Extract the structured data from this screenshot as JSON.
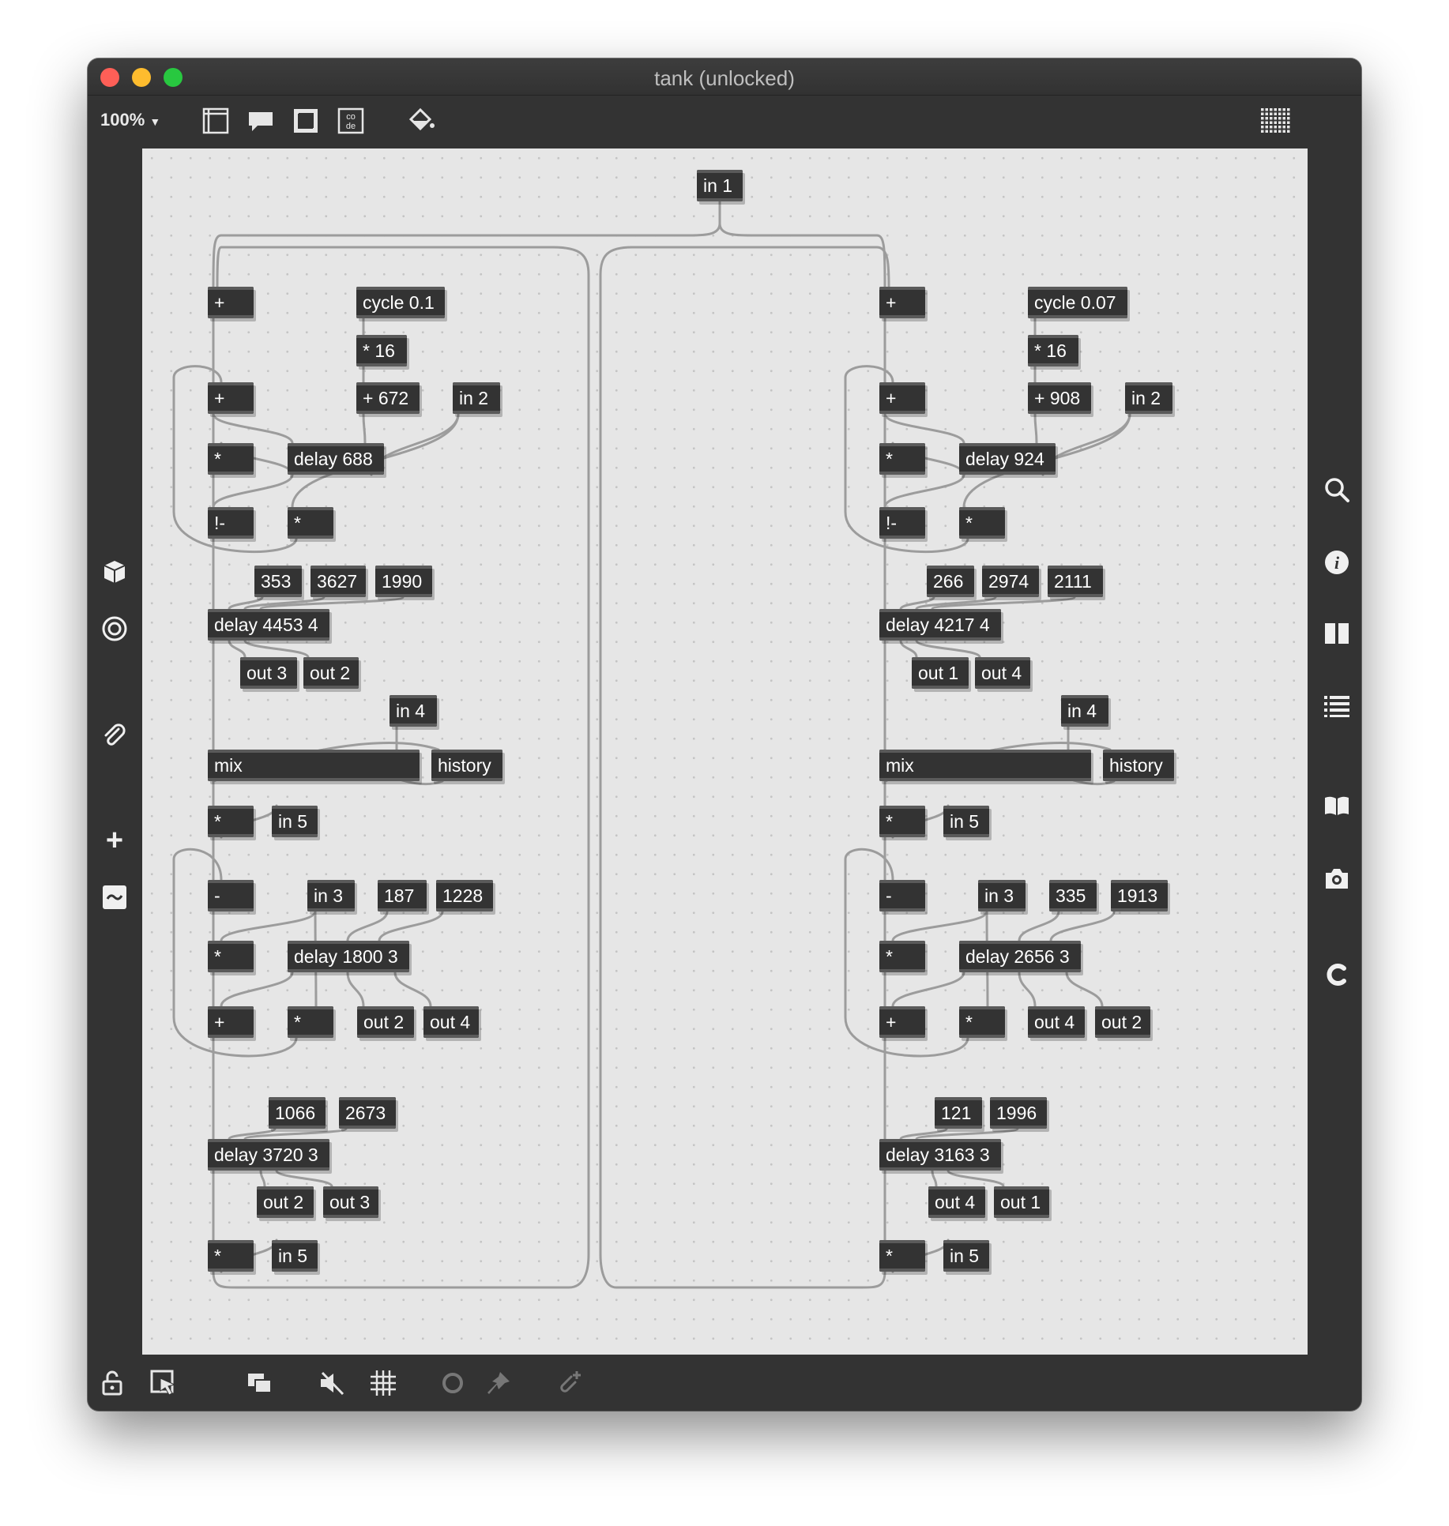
{
  "window": {
    "title": "tank (unlocked)",
    "zoom": "100%"
  },
  "colors": {
    "canvas": "#e6e6e6",
    "object": "#333333",
    "cord": "#9c9c9c",
    "close": "#fe5f57",
    "minimize": "#febc2e",
    "zoom": "#28c840"
  },
  "toolbar": {
    "icons": [
      "presentation-icon",
      "comment-icon",
      "area-icon",
      "code-icon",
      "paint-bucket-icon",
      "grid-menu-icon"
    ]
  },
  "left_sidebar": {
    "icons": [
      "package-icon",
      "target-icon",
      "paperclip-icon",
      "plus-icon",
      "tilde-icon"
    ]
  },
  "right_sidebar": {
    "icons": [
      "search-icon",
      "info-icon",
      "columns-icon",
      "list-icon",
      "book-icon",
      "camera-icon",
      "c-icon"
    ]
  },
  "bottom_toolbar": {
    "icons": [
      "lock-icon",
      "select-icon",
      "layers-icon",
      "mute-icon",
      "grid-icon",
      "loop-icon",
      "pin-icon",
      "paperclip-add-icon"
    ]
  },
  "objects": {
    "in1": "in 1",
    "l_add1": "+",
    "l_cycle": "cycle 0.1",
    "l_mul16": "* 16",
    "l_add2": "+",
    "l_add672": "+ 672",
    "l_in2": "in 2",
    "l_mul1": "*",
    "l_delay688": "delay 688",
    "l_rsub": "!-",
    "l_mul2": "*",
    "l_n353": "353",
    "l_n3627": "3627",
    "l_n1990": "1990",
    "l_delay4453": "delay 4453 4",
    "l_out3a": "out 3",
    "l_out2a": "out 2",
    "l_in4": "in 4",
    "l_mix": "mix",
    "l_history": "history",
    "l_mul3": "*",
    "l_in5a": "in 5",
    "l_sub": "-",
    "l_in3": "in 3",
    "l_n187": "187",
    "l_n1228": "1228",
    "l_mul4": "*",
    "l_delay1800": "delay 1800 3",
    "l_add3": "+",
    "l_mul5": "*",
    "l_out2b": "out 2",
    "l_out4b": "out 4",
    "l_n1066": "1066",
    "l_n2673": "2673",
    "l_delay3720": "delay 3720 3",
    "l_out2c": "out 2",
    "l_out3c": "out 3",
    "l_mul6": "*",
    "l_in5b": "in 5",
    "r_add1": "+",
    "r_cycle": "cycle 0.07",
    "r_mul16": "* 16",
    "r_add2": "+",
    "r_add908": "+ 908",
    "r_in2": "in 2",
    "r_mul1": "*",
    "r_delay924": "delay 924",
    "r_rsub": "!-",
    "r_mul2": "*",
    "r_n266": "266",
    "r_n2974": "2974",
    "r_n2111": "2111",
    "r_delay4217": "delay 4217 4",
    "r_out1a": "out 1",
    "r_out4a": "out 4",
    "r_in4": "in 4",
    "r_mix": "mix",
    "r_history": "history",
    "r_mul3": "*",
    "r_in5a": "in 5",
    "r_sub": "-",
    "r_in3": "in 3",
    "r_n335": "335",
    "r_n1913": "1913",
    "r_mul4": "*",
    "r_delay2656": "delay 2656 3",
    "r_add3": "+",
    "r_mul5": "*",
    "r_out4b": "out 4",
    "r_out2b": "out 2",
    "r_n121": "121",
    "r_n1996": "1996",
    "r_delay3163": "delay 3163 3",
    "r_out4c": "out 4",
    "r_out1c": "out 1",
    "r_mul6": "*",
    "r_in5b": "in 5"
  }
}
